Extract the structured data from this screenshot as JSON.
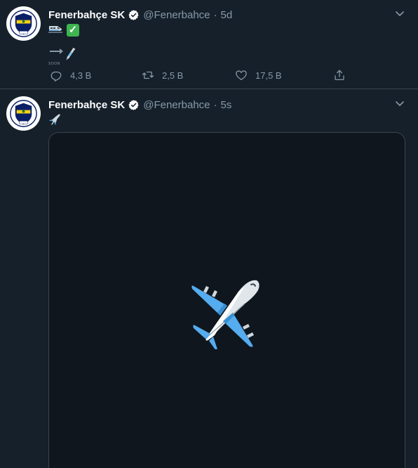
{
  "tweets": [
    {
      "name": "Fenerbahçe SK",
      "handle": "@Fenerbahce",
      "separator": "·",
      "time": "5d",
      "content_icons": [
        "train-emoji",
        "check-emoji",
        "soon-arrow-emoji",
        "syringe-emoji"
      ],
      "soon_label": "SOON",
      "check_glyph": "✓",
      "actions": {
        "reply_count": "4,3 B",
        "retweet_count": "2,5 B",
        "like_count": "17,5 B"
      }
    },
    {
      "name": "Fenerbahçe SK",
      "handle": "@Fenerbahce",
      "separator": "·",
      "time": "5s",
      "content_icons": [
        "airplane-emoji"
      ],
      "media": {
        "icon": "airplane-emoji"
      }
    }
  ],
  "colors": {
    "background": "#15202b",
    "media_background": "#0f161e",
    "border": "#38444d",
    "secondary_text": "#8899a6",
    "verified_badge": "#ffffff",
    "club_yellow": "#f7d117",
    "club_navy": "#0a1f66"
  }
}
